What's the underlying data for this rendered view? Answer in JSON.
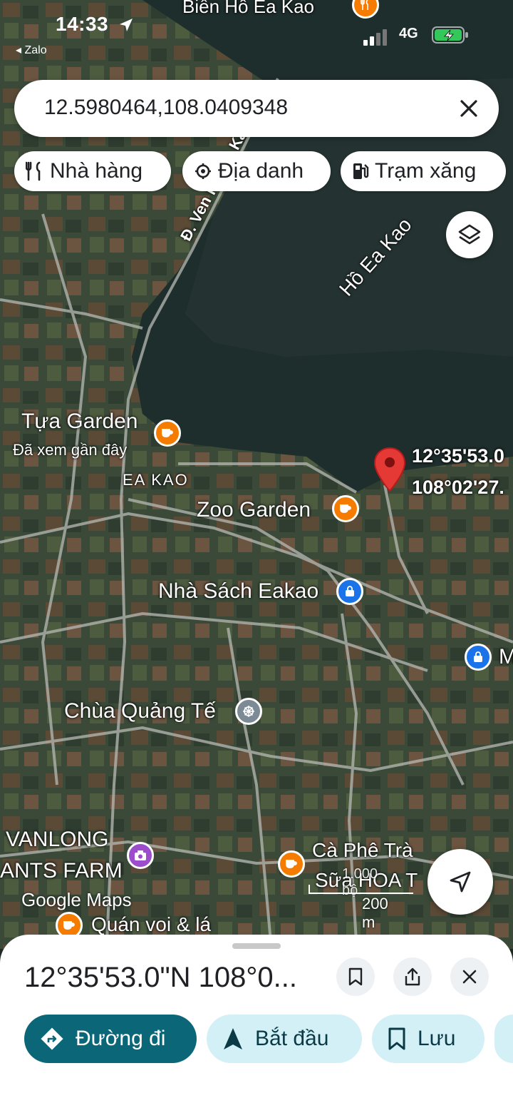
{
  "status_bar": {
    "time": "14:33",
    "back_app": "Zalo",
    "network": "4G"
  },
  "search": {
    "query": "12.5980464,108.0409348"
  },
  "chips": [
    {
      "label": "Nhà hàng",
      "icon": "restaurant-icon"
    },
    {
      "label": "Địa danh",
      "icon": "landmark-icon"
    },
    {
      "label": "Trạm xăng",
      "icon": "gas-station-icon"
    }
  ],
  "map_labels": {
    "top_place": "Biển Hồ Ea Kao",
    "road": "Đ. Ven Hồ EA Kao",
    "lake": "Hồ Ea Kao",
    "tua_garden": "Tựa Garden",
    "tua_garden_sub": "Đã xem gần đây",
    "area": "EA KAO",
    "zoo_garden": "Zoo Garden",
    "pin_lat": "12°35'53.0",
    "pin_lng": "108°02'27.",
    "bookstore": "Nhà Sách Eakao",
    "right_edge": "M",
    "pagoda": "Chùa Quảng Tế",
    "farm_line1": "VANLONG",
    "farm_line2": "ANTS FARM",
    "cafe_line1": "Cà Phê Trà",
    "cafe_line2": "Sữa HOA T",
    "restaurant_bottom": "Quán voi & lá",
    "watermark": "Google Maps"
  },
  "scale_bar": {
    "label": "200 m",
    "overlap_text": "1.000 bộ"
  },
  "bottom_sheet": {
    "coordinates": "12°35'53.0\"N 108°0...",
    "actions": [
      {
        "label": "Đường đi",
        "icon": "directions-icon"
      },
      {
        "label": "Bắt đầu",
        "icon": "navigation-arrow-icon"
      },
      {
        "label": "Lưu",
        "icon": "bookmark-icon"
      }
    ]
  },
  "colors": {
    "primary_action": "#0b6778",
    "secondary_action_bg": "#d3f0f7",
    "secondary_action_text": "#0b3a47",
    "pin_red": "#e53935",
    "poi_orange": "#f57c00",
    "poi_blue": "#1a73e8",
    "poi_gray": "#7b8a95",
    "poi_purple": "#9c4dcc",
    "battery_green": "#34c759"
  }
}
